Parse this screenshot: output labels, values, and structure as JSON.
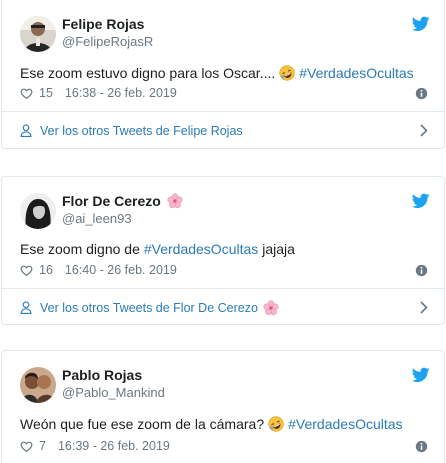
{
  "tweets": [
    {
      "name": "Felipe Rojas",
      "handle": "@FelipeRojasR",
      "text_before": "Ese zoom estuvo digno para los Oscar....",
      "emoji": "rofl-emoji",
      "hashtag": "#VerdadesOcultas",
      "text_after": "",
      "likes": "15",
      "timestamp": "16:38 - 26 feb. 2019",
      "footer": "Ver los otros Tweets de Felipe Rojas"
    },
    {
      "name": "Flor De Cerezo",
      "name_emoji": "cherry-blossom-emoji",
      "handle": "@ai_leen93",
      "text_before": "Ese zoom digno de",
      "hashtag": "#VerdadesOcultas",
      "text_after": "jajaja",
      "likes": "16",
      "timestamp": "16:40 - 26 feb. 2019",
      "footer": "Ver los otros Tweets de Flor De Cerezo"
    },
    {
      "name": "Pablo Rojas",
      "handle": "@Pablo_Mankind",
      "text_before": "Weón que fue ese zoom de la cámara?",
      "emoji": "rofl-emoji",
      "hashtag": "#VerdadesOcultas",
      "text_after": "",
      "likes": "7",
      "timestamp": "16:39 - 26 feb. 2019"
    }
  ],
  "colors": {
    "link": "#2b7bb9",
    "twitter_blue": "#1da1f2",
    "muted": "#697882",
    "border": "#e1e8ed"
  }
}
